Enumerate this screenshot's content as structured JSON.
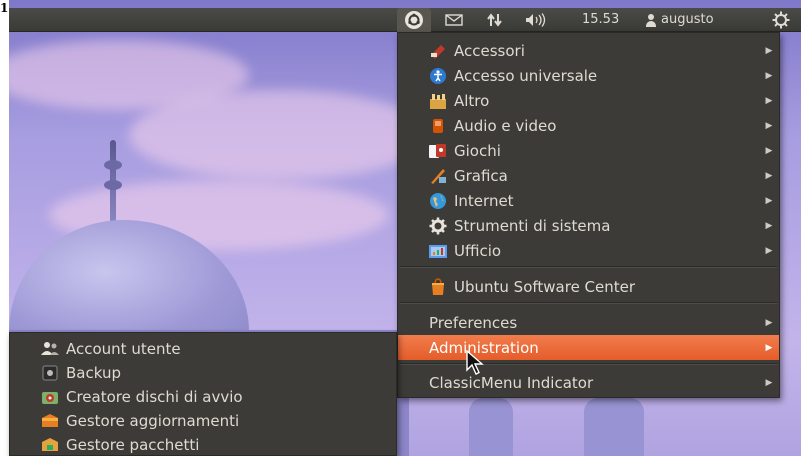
{
  "page": {
    "corner_label": "1"
  },
  "panel": {
    "classic_icon": "classicmenu-indicator-icon",
    "mail_icon": "mail-icon",
    "network_icon": "network-updown-icon",
    "volume_icon": "volume-icon",
    "clock": "15.53",
    "user_icon": "user-icon",
    "username": "augusto",
    "session_icon": "power-gear-icon"
  },
  "menu": {
    "categories": [
      {
        "label": "Accessori",
        "icon": "accessories-icon",
        "color": "#c0392b"
      },
      {
        "label": "Accesso universale",
        "icon": "universal-access-icon",
        "color": "#2e7ad1"
      },
      {
        "label": "Altro",
        "icon": "other-icon",
        "color": "#d9a441"
      },
      {
        "label": "Audio e video",
        "icon": "audio-video-icon",
        "color": "#d35400"
      },
      {
        "label": "Giochi",
        "icon": "games-icon",
        "color": "#c0392b"
      },
      {
        "label": "Grafica",
        "icon": "graphics-icon",
        "color": "#e67e22"
      },
      {
        "label": "Internet",
        "icon": "internet-icon",
        "color": "#3498db"
      },
      {
        "label": "Strumenti di sistema",
        "icon": "system-tools-icon",
        "color": "#cfcac0"
      },
      {
        "label": "Ufficio",
        "icon": "office-icon",
        "color": "#5d9cec"
      }
    ],
    "software_center": {
      "label": "Ubuntu Software Center",
      "icon": "software-center-icon",
      "color": "#e67e22"
    },
    "preferences": "Preferences",
    "administration": "Administration",
    "classic_menu_indicator": "ClassicMenu Indicator",
    "accent": "#f07746"
  },
  "submenu": {
    "items": [
      {
        "label": "Account utente",
        "icon": "users-icon",
        "color": "#cfcac0"
      },
      {
        "label": "Backup",
        "icon": "backup-icon",
        "color": "#555"
      },
      {
        "label": "Creatore dischi di avvio",
        "icon": "startup-disk-icon",
        "color": "#c0392b"
      },
      {
        "label": "Gestore aggiornamenti",
        "icon": "update-manager-icon",
        "color": "#e67e22"
      },
      {
        "label": "Gestore pacchetti",
        "icon": "package-manager-icon",
        "color": "#e6a23c"
      }
    ]
  }
}
